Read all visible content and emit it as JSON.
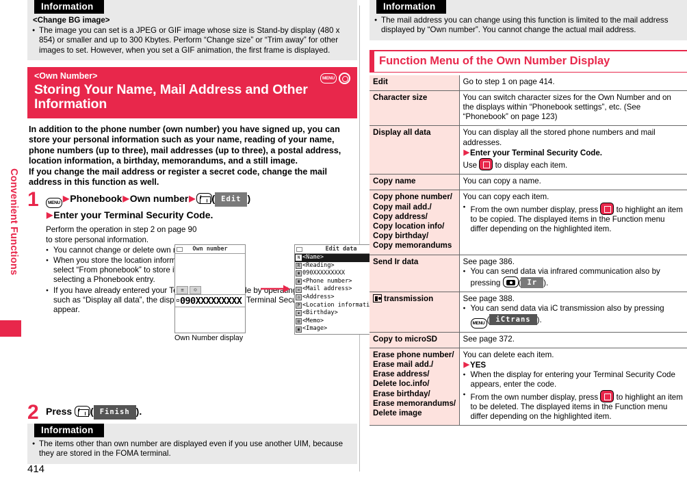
{
  "sidebar": {
    "chapter_label": "Convenient Functions"
  },
  "page_number": "414",
  "left": {
    "info_top": {
      "tag": "Information",
      "subheading": "<Change BG image>",
      "bullets": [
        "The image you can set is a JPEG or GIF image whose size is Stand-by display (480 x 854) or smaller and up to 300 Kbytes. Perform “Change size” or “Trim away” for other images to set. However, when you set a GIF animation, the first frame is displayed."
      ]
    },
    "banner": {
      "subtitle": "<Own Number>",
      "title": "Storing Your Name, Mail Address and Other Information",
      "icons": [
        "menu-key-icon",
        "nav-circle-icon"
      ]
    },
    "intro": "In addition to the phone number (own number) you have signed up, you can store your personal information such as your name, reading of your name, phone numbers (up to three), mail addresses (up to three), a postal address, location information, a birthday, memorandums, and a still image.\nIf you change the mail address or register a secret code, change the mail address in this function as well.",
    "steps": [
      {
        "number": "1",
        "head_parts": [
          "Phonebook",
          "Own number"
        ],
        "softkey": "Edit",
        "head_line2": "Enter your Terminal Security Code.",
        "body_intro": "Perform the operation in step 2 on page 90 to store personal information.",
        "bullets": [
          "You cannot change or delete own number.",
          "When you store the location information, select “From phonebook” to store it by selecting a Phonebook entry.",
          "If you have already entered your Terminal Security Code by operating another function such as “Display all data”, the display for entering your Terminal Security Code does not appear."
        ]
      },
      {
        "number": "2",
        "press_label": "Press",
        "softkey": "Finish"
      }
    ],
    "figure": {
      "caption": "Own Number display",
      "phone1": {
        "titlebar": "Own number",
        "number": "090XXXXXXXXX",
        "tabs": [
          "list-icon",
          "person-icon"
        ]
      },
      "phone2": {
        "titlebar": "Edit data",
        "rows": [
          {
            "icon": "N",
            "label": "<Name>",
            "selected": true
          },
          {
            "icon": "R",
            "label": "<Reading>",
            "selected": false
          },
          {
            "icon": "☎",
            "label": "090XXXXXXXXX",
            "selected": false
          },
          {
            "icon": "☎",
            "label": "<Phone number>",
            "selected": false
          },
          {
            "icon": "✉",
            "label": "<Mail address>",
            "selected": false
          },
          {
            "icon": "⌂",
            "label": "<Address>",
            "selected": false
          },
          {
            "icon": "P",
            "label": "<Location information>",
            "selected": false
          },
          {
            "icon": "❀",
            "label": "<Birthday>",
            "selected": false
          },
          {
            "icon": "▤",
            "label": "<Memo>",
            "selected": false
          },
          {
            "icon": "▣",
            "label": "<Image>",
            "selected": false
          }
        ]
      }
    },
    "info_bottom": {
      "tag": "Information",
      "bullets": [
        "The items other than own number are displayed even if you use another UIM, because they are stored in the FOMA terminal."
      ]
    }
  },
  "right": {
    "info_top": {
      "tag": "Information",
      "bullets": [
        "The mail address you can change using this function is limited to the mail address displayed by “Own number”. You cannot change the actual mail address."
      ]
    },
    "section_title": "Function Menu of the Own Number Display",
    "table": {
      "rows": [
        {
          "label": "Edit",
          "desc_lines": [
            {
              "type": "text",
              "text": "Go to step 1 on page 414."
            }
          ]
        },
        {
          "label": "Character size",
          "desc_lines": [
            {
              "type": "text",
              "text": "You can switch character sizes for the Own Number and on the displays within “Phonebook settings”, etc. (See “Phonebook” on page 123)"
            }
          ]
        },
        {
          "label": "Display all data",
          "desc_lines": [
            {
              "type": "text",
              "text": "You can display all the stored phone numbers and mail addresses."
            },
            {
              "type": "arrow",
              "text": "Enter your Terminal Security Code."
            },
            {
              "type": "key-nav",
              "pre": "Use",
              "post": "to display each item."
            }
          ]
        },
        {
          "label": "Copy name",
          "desc_lines": [
            {
              "type": "text",
              "text": "You can copy a name."
            }
          ]
        },
        {
          "label": "Copy phone number/\nCopy mail add./\nCopy address/\nCopy location info/\nCopy birthday/\nCopy memorandums",
          "desc_lines": [
            {
              "type": "text",
              "text": "You can copy each item."
            },
            {
              "type": "bullet-key-nav",
              "pre": "From the own number display, press",
              "post": "to highlight an item to be copied. The displayed items in the Function menu differ depending on the highlighted item."
            }
          ]
        },
        {
          "label": "Send Ir data",
          "desc_lines": [
            {
              "type": "text",
              "text": "See page 386."
            },
            {
              "type": "bullet-key-cam",
              "pre": "You can send data via infrared communication also by pressing",
              "softkey": "Ir",
              "post": "."
            }
          ]
        },
        {
          "label": "transmission",
          "label_icon": "ic-transmission-icon",
          "desc_lines": [
            {
              "type": "text",
              "text": "See page 388."
            },
            {
              "type": "bullet-key-menu",
              "pre": "You can send data via iC transmission also by pressing",
              "softkey": "iCtrans",
              "post": "."
            }
          ]
        },
        {
          "label": "Copy to microSD",
          "desc_lines": [
            {
              "type": "text",
              "text": "See page 372."
            }
          ]
        },
        {
          "label": "Erase phone number/\nErase mail add./\nErase address/\nDelete loc.info/\nErase birthday/\nErase memorandums/\nDelete image",
          "desc_lines": [
            {
              "type": "text",
              "text": "You can delete each item."
            },
            {
              "type": "arrow",
              "text": "YES"
            },
            {
              "type": "text-bullet",
              "text": "When the display for entering your Terminal Security Code appears, enter the code."
            },
            {
              "type": "bullet-key-nav",
              "pre": "From the own number display, press",
              "post": "to highlight an item to be deleted. The displayed items in the Function menu differ depending on the highlighted item."
            }
          ]
        }
      ]
    }
  },
  "colors": {
    "accent_red": "#e8274b",
    "table_label_bg": "#fde2de",
    "info_bg": "#e9e9e9"
  }
}
